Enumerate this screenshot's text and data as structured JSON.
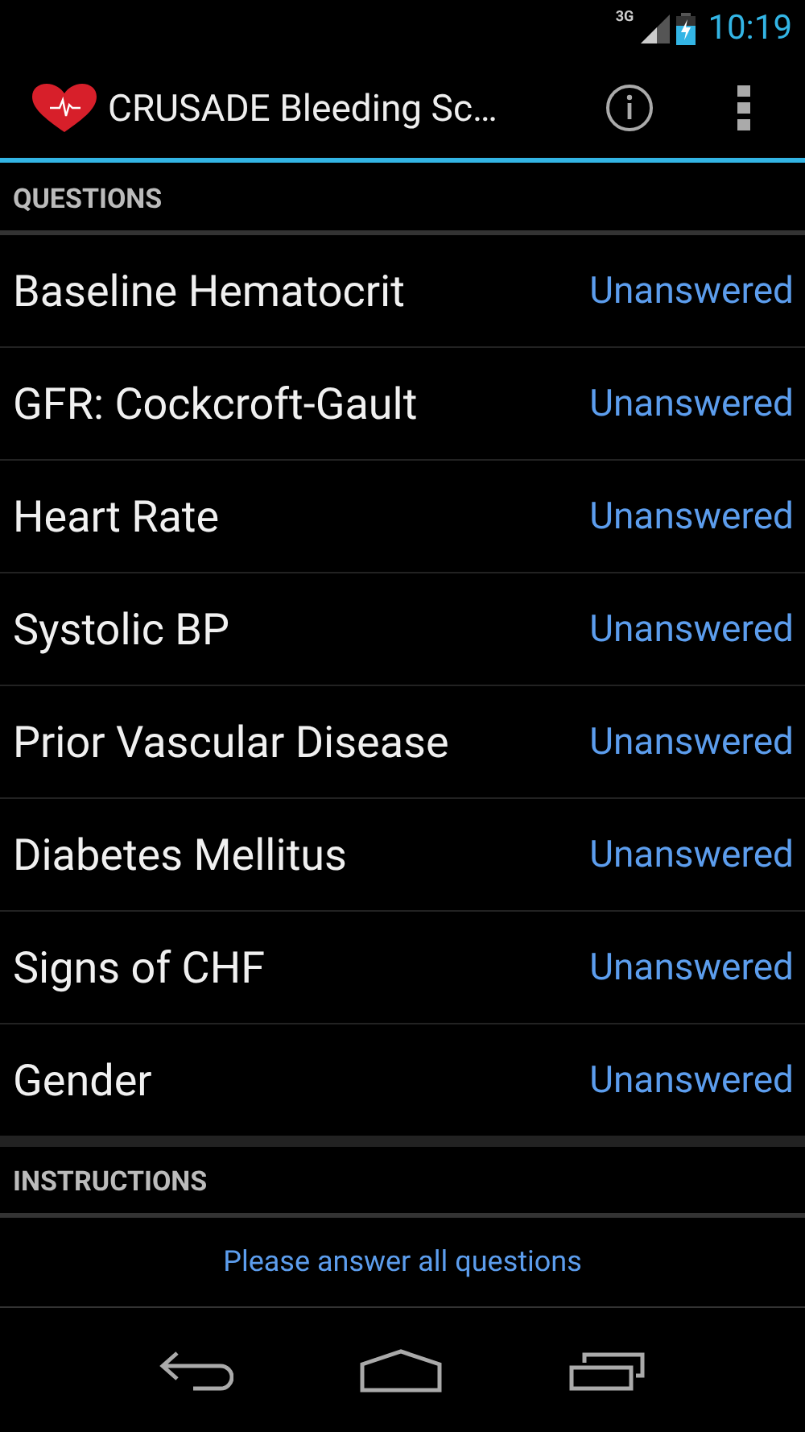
{
  "status_bar": {
    "network": "3G",
    "time": "10:19"
  },
  "action_bar": {
    "title": "CRUSADE Bleeding Sc…"
  },
  "questions": {
    "header": "QUESTIONS",
    "rows": [
      {
        "label": "Baseline Hematocrit",
        "value": "Unanswered"
      },
      {
        "label": "GFR: Cockcroft-Gault",
        "value": "Unanswered"
      },
      {
        "label": "Heart Rate",
        "value": "Unanswered"
      },
      {
        "label": "Systolic BP",
        "value": "Unanswered"
      },
      {
        "label": "Prior Vascular Disease",
        "value": "Unanswered"
      },
      {
        "label": "Diabetes Mellitus",
        "value": "Unanswered"
      },
      {
        "label": "Signs of CHF",
        "value": "Unanswered"
      },
      {
        "label": "Gender",
        "value": "Unanswered"
      }
    ]
  },
  "instructions": {
    "header": "INSTRUCTIONS",
    "message": "Please answer all questions"
  }
}
